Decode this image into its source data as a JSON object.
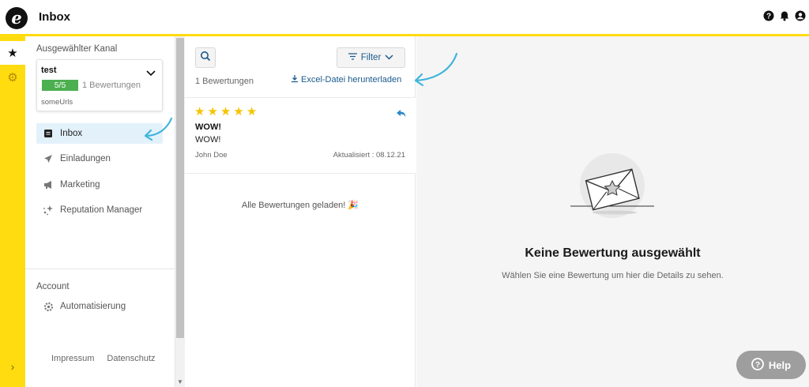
{
  "app": {
    "title": "Inbox"
  },
  "sidebar": {
    "channel_label": "Ausgewählter Kanal",
    "channel": {
      "name": "test",
      "score": "5/5",
      "count": "1 Bewertungen",
      "urls": "someUrls"
    },
    "nav": [
      {
        "label": "Inbox",
        "icon": "inbox-icon"
      },
      {
        "label": "Einladungen",
        "icon": "paper-plane-icon"
      },
      {
        "label": "Marketing",
        "icon": "megaphone-icon"
      },
      {
        "label": "Reputation Manager",
        "icon": "sparkles-icon"
      }
    ],
    "account_label": "Account",
    "account_nav": [
      {
        "label": "Automatisierung",
        "icon": "gear-automation-icon"
      }
    ],
    "footer": {
      "impressum": "Impressum",
      "datenschutz": "Datenschutz"
    }
  },
  "list": {
    "filter_label": "Filter",
    "review_count": "1 Bewertungen",
    "excel_label": "Excel-Datei herunterladen",
    "reviews": [
      {
        "stars": 5,
        "title": "WOW!",
        "text": "WOW!",
        "author": "John Doe",
        "date": "Aktualisiert : 08.12.21"
      }
    ],
    "all_loaded": "Alle Bewertungen geladen! 🎉"
  },
  "detail": {
    "empty_title": "Keine Bewertung ausgewählt",
    "empty_subtitle": "Wählen Sie eine Bewertung um hier die Details zu sehen."
  },
  "help": {
    "label": "Help"
  },
  "colors": {
    "accent": "#ffdc0f",
    "link": "#1c5a8c",
    "badge": "#4caf50",
    "star": "#f5c400",
    "annotation": "#3fb5dc"
  }
}
